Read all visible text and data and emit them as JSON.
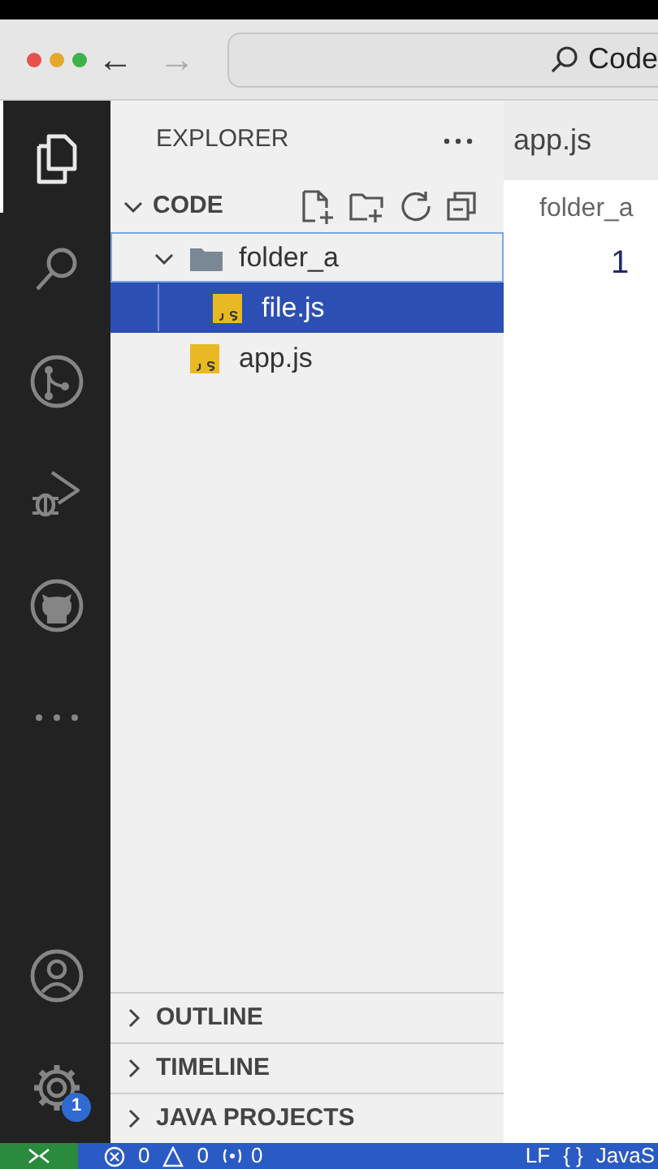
{
  "window": {
    "nav_buttons": [
      {
        "glyph": "←",
        "disabled": false
      },
      {
        "glyph": "→",
        "disabled": true
      }
    ],
    "search": "Code"
  },
  "activity_bar": {
    "items": [
      {
        "kind": "explorer",
        "selected": true
      },
      {
        "kind": "search",
        "selected": false
      },
      {
        "kind": "source-control",
        "selected": false
      },
      {
        "kind": "run-debug",
        "selected": false
      },
      {
        "kind": "github",
        "selected": false
      },
      {
        "kind": "more",
        "selected": false
      }
    ],
    "manage_badge": "1"
  },
  "sidebar": {
    "title": "EXPLORER",
    "section": {
      "title": "CODE",
      "expanded": true
    },
    "tree": [
      {
        "label": "folder_a",
        "kind": "folder",
        "expanded": true,
        "selected": false,
        "focused": true,
        "children": [
          {
            "label": "file.js",
            "kind": "js",
            "selected": true,
            "focused": false
          }
        ]
      },
      {
        "label": "app.js",
        "kind": "js",
        "selected": false,
        "focused": false
      }
    ],
    "panels": [
      {
        "title": "OUTLINE",
        "expanded": false
      },
      {
        "title": "TIMELINE",
        "expanded": false
      },
      {
        "title": "JAVA PROJECTS",
        "expanded": false
      }
    ]
  },
  "editor": {
    "tabs": [
      {
        "label": "app.js",
        "selected": false
      }
    ],
    "breadcrumb": "folder_a",
    "line_numbers": [
      "1"
    ]
  },
  "status_bar": {
    "errors": "0",
    "warnings": "0",
    "ports": "0",
    "eol": "LF",
    "braces": "{ }",
    "language": "JavaS"
  }
}
